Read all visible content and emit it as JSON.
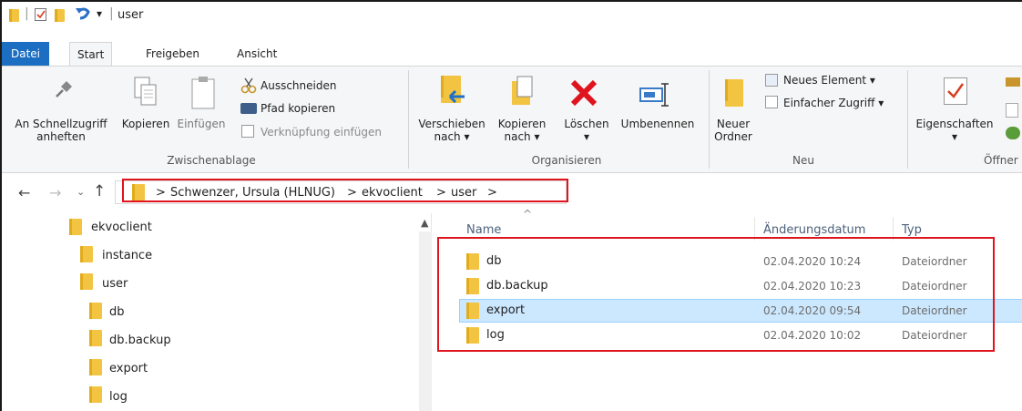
{
  "window": {
    "title": "user"
  },
  "tabs": [
    {
      "label": "Datei"
    },
    {
      "label": "Start"
    },
    {
      "label": "Freigeben"
    },
    {
      "label": "Ansicht"
    }
  ],
  "ribbon": {
    "clipboard": {
      "pin_label_1": "An Schnellzugriff",
      "pin_label_2": "anheften",
      "copy_label": "Kopieren",
      "paste_label": "Einfügen",
      "cut_label": "Ausschneiden",
      "copy_path_label": "Pfad kopieren",
      "paste_shortcut_label": "Verknüpfung einfügen",
      "group_label": "Zwischenablage"
    },
    "organize": {
      "move_label_1": "Verschieben",
      "move_label_2": "nach ▾",
      "copyto_label_1": "Kopieren",
      "copyto_label_2": "nach ▾",
      "delete_label": "Löschen",
      "delete_arrow": "▾",
      "rename_label": "Umbenennen",
      "group_label": "Organisieren"
    },
    "new": {
      "new_folder_1": "Neuer",
      "new_folder_2": "Ordner",
      "new_item_label": "Neues Element ▾",
      "easy_access_label": "Einfacher Zugriff ▾",
      "group_label": "Neu"
    },
    "open": {
      "properties_label": "Eigenschaften",
      "properties_arrow": "▾",
      "group_label": "Öffner"
    }
  },
  "address": {
    "crumbs": [
      "Schwenzer, Ursula (HLNUG)",
      "ekvoclient",
      "user"
    ],
    "separator": ">"
  },
  "nav_tree": [
    {
      "label": "ekvoclient",
      "level": 0
    },
    {
      "label": "instance",
      "level": 1
    },
    {
      "label": "user",
      "level": 1
    },
    {
      "label": "db",
      "level": 2
    },
    {
      "label": "db.backup",
      "level": 2
    },
    {
      "label": "export",
      "level": 2
    },
    {
      "label": "log",
      "level": 2
    }
  ],
  "columns": {
    "name": "Name",
    "date": "Änderungsdatum",
    "type": "Typ"
  },
  "files": [
    {
      "name": "db",
      "date": "02.04.2020 10:24",
      "type": "Dateiordner",
      "selected": false
    },
    {
      "name": "db.backup",
      "date": "02.04.2020 10:23",
      "type": "Dateiordner",
      "selected": false
    },
    {
      "name": "export",
      "date": "02.04.2020 09:54",
      "type": "Dateiordner",
      "selected": true
    },
    {
      "name": "log",
      "date": "02.04.2020 10:02",
      "type": "Dateiordner",
      "selected": false
    }
  ],
  "colors": {
    "accent": "#1b6ec2",
    "highlight": "#e0141e",
    "selection": "#cce8ff"
  }
}
